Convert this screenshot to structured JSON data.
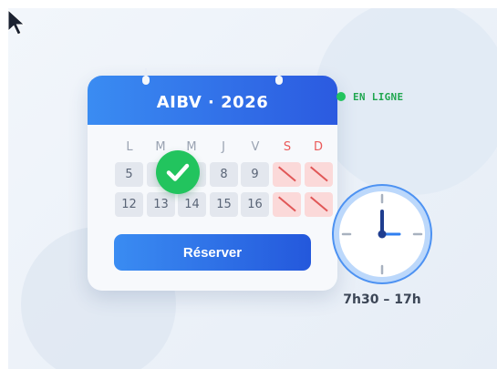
{
  "calendar": {
    "title": "AIBV · 2026",
    "weekdays": [
      "L",
      "M",
      "M",
      "J",
      "V",
      "S",
      "D"
    ],
    "week1": [
      "5",
      "",
      "",
      "8",
      "9",
      "",
      ""
    ],
    "week2": [
      "12",
      "13",
      "14",
      "15",
      "16",
      "",
      ""
    ],
    "selected_icon": "checkmark-icon",
    "unavailable_icon": "slash-icon"
  },
  "actions": {
    "reserve_label": "Réserver"
  },
  "status": {
    "label": "EN LIGNE",
    "icon": "online-dot-icon"
  },
  "hours": {
    "label": "7h30 – 17h",
    "icon": "clock-icon"
  },
  "colors": {
    "accent": "#2f6fe8",
    "available": "#22c45e",
    "weekend": "#ea5a5a",
    "day_cell": "#e3e7ee",
    "day_closed": "#fbd9d9"
  }
}
